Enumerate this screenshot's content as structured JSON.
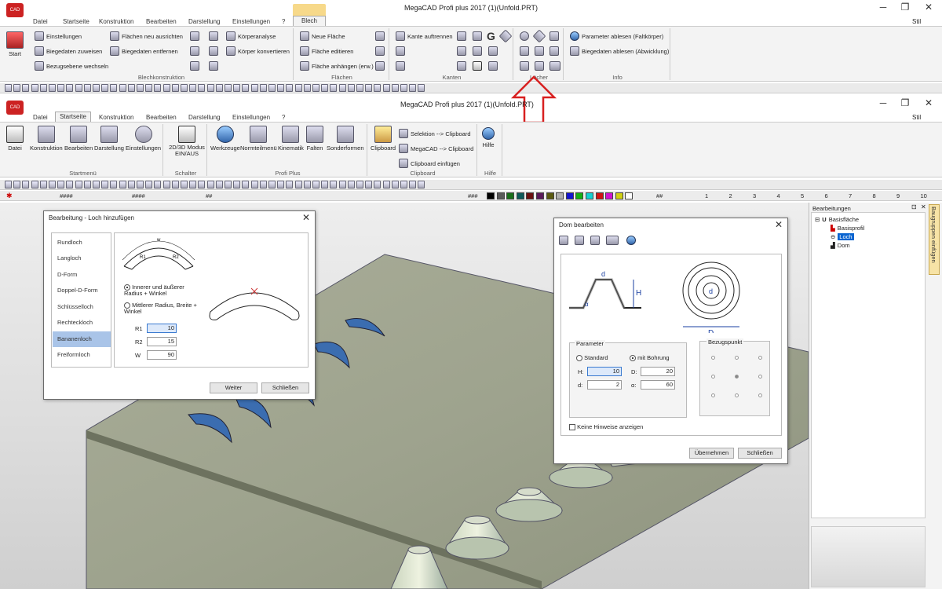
{
  "top_window": {
    "title": "MegaCAD Profi plus 2017 (1)(Unfold.PRT)",
    "menu": [
      "Datei",
      "Startseite",
      "Konstruktion",
      "Bearbeiten",
      "Darstellung",
      "Einstellungen",
      "?"
    ],
    "active_tab": "Blech",
    "style_label": "Stil",
    "start_label": "Start",
    "groups": {
      "blechkonstruktion": {
        "label": "Blechkonstruktion",
        "items": [
          "Einstellungen",
          "Biegedaten zuweisen",
          "Bezugsebene wechseln",
          "Flächen neu ausrichten",
          "Biegedaten entfernen",
          "Körperanalyse",
          "Körper konvertieren"
        ]
      },
      "flaechen": {
        "label": "Flächen",
        "items": [
          "Neue Fläche",
          "Fläche editieren",
          "Fläche anhängen (erw.)"
        ]
      },
      "kanten": {
        "label": "Kanten",
        "items": [
          "Kante auftrennen"
        ]
      },
      "loecher": {
        "label": "Löcher"
      },
      "info": {
        "label": "Info",
        "items": [
          "Parameter ablesen (Faltkörper)",
          "Biegedaten ablesen (Abwicklung)"
        ]
      }
    }
  },
  "second_window": {
    "title": "MegaCAD Profi plus 2017 (1)(Unfold.PRT)",
    "menu": [
      "Datei",
      "Startseite",
      "Konstruktion",
      "Bearbeiten",
      "Darstellung",
      "Einstellungen",
      "?"
    ],
    "active_tab": "Startseite",
    "style_label": "Stil",
    "groups": {
      "startmenu": {
        "label": "Startmenü",
        "items": [
          "Datei",
          "Konstruktion",
          "Bearbeiten",
          "Darstellung",
          "Einstellungen"
        ]
      },
      "schalter": {
        "label": "Schalter",
        "items": [
          "2D/3D Modus EIN/AUS"
        ]
      },
      "profiplus": {
        "label": "Profi Plus",
        "items": [
          "Werkzeuge",
          "Normteilmenü",
          "Kinematik",
          "Falten",
          "Sonderformen"
        ]
      },
      "clipboard": {
        "label": "Clipboard",
        "items": [
          "Clipboard",
          "Selektion --> Clipboard",
          "MegaCAD --> Clipboard",
          "Clipboard einfügen"
        ]
      },
      "hilfe": {
        "label": "Hilfe",
        "items": [
          "Hilfe"
        ]
      }
    },
    "toolbar_hash": "####",
    "toolbar_hash3": "###",
    "toolbar_hash2": "##",
    "numbers": [
      "1",
      "2",
      "3",
      "4",
      "5",
      "6",
      "7",
      "8",
      "9",
      "10"
    ],
    "colors": [
      "#000000",
      "#5a5a5a",
      "#1a6e1a",
      "#0e5a5a",
      "#6a1010",
      "#5a1a5a",
      "#5a5a10",
      "#b0b0b0",
      "#1414d0",
      "#14b014",
      "#14d0d0",
      "#d01414",
      "#d014d0",
      "#d0d014",
      "#ffffff"
    ]
  },
  "loch_dialog": {
    "title": "Bearbeitung - Loch hinzufügen",
    "list": [
      "Rundloch",
      "Langloch",
      "D-Form",
      "Doppel-D-Form",
      "Schlüsselloch",
      "Rechteckloch",
      "Bananenloch",
      "Freiformloch"
    ],
    "selected": "Bananenloch",
    "option1": "Innerer und äußerer Radius + Winkel",
    "option2": "Mittlerer Radius, Breite + Winkel",
    "fields": [
      {
        "label": "R1",
        "value": "10"
      },
      {
        "label": "R2",
        "value": "15"
      },
      {
        "label": "W",
        "value": "90"
      }
    ],
    "diagram_labels": {
      "w": "w",
      "r1": "R1",
      "r2": "R2"
    },
    "btn_next": "Weiter",
    "btn_close": "Schließen"
  },
  "dom_dialog": {
    "title": "Dom bearbeiten",
    "diagram_labels": {
      "d": "d",
      "H": "H",
      "alpha": "α",
      "D": "D"
    },
    "parameter_label": "Parameter",
    "standard": "Standard",
    "mit_bohrung": "mit Bohrung",
    "bezugspunkt": "Bezugspunkt",
    "fields": {
      "H": "10",
      "D": "20",
      "d": "2",
      "alpha": "60"
    },
    "field_labels": {
      "H": "H:",
      "D": "D:",
      "d": "d:",
      "alpha": "α:"
    },
    "hint": "Keine Hinweise anzeigen",
    "btn_apply": "Übernehmen",
    "btn_close": "Schließen"
  },
  "right_panel": {
    "title": "Bearbeitungen",
    "side_tab": "Baugruppen einfügen",
    "tree": [
      "Basisfläche",
      "Basisprofil",
      "Loch",
      "Dom"
    ],
    "selected": "Loch"
  },
  "arrow_color": "#d82020"
}
